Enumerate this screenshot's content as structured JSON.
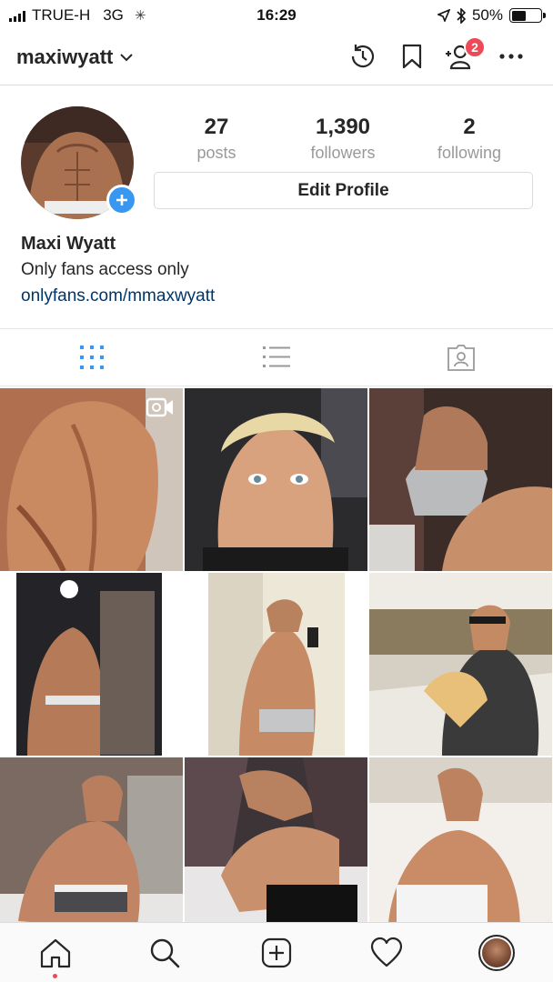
{
  "status_bar": {
    "carrier": "TRUE-H",
    "network": "3G",
    "time": "16:29",
    "battery": "50%",
    "battery_level": 0.5
  },
  "header": {
    "username": "maxiwyatt",
    "notification_count": "2"
  },
  "profile": {
    "stats": [
      {
        "value": "27",
        "label": "posts"
      },
      {
        "value": "1,390",
        "label": "followers"
      },
      {
        "value": "2",
        "label": "following"
      }
    ],
    "edit_button": "Edit Profile",
    "full_name": "Maxi Wyatt",
    "bio": "Only fans access only",
    "website": "onlyfans.com/mmaxwyatt"
  },
  "tabs": [
    {
      "name": "grid-view",
      "icon": "grid-icon",
      "active": true
    },
    {
      "name": "list-view",
      "icon": "list-icon",
      "active": false
    },
    {
      "name": "tagged",
      "icon": "tagged-person-icon",
      "active": false
    }
  ],
  "posts": [
    {
      "type": "video",
      "icon": "video-icon"
    },
    {
      "type": "photo"
    },
    {
      "type": "photo"
    },
    {
      "type": "photo"
    },
    {
      "type": "photo"
    },
    {
      "type": "photo"
    },
    {
      "type": "photo"
    },
    {
      "type": "photo"
    },
    {
      "type": "photo"
    }
  ],
  "nav": [
    "home-icon",
    "search-icon",
    "new-post-icon",
    "activity-heart-icon",
    "profile-avatar"
  ],
  "colors": {
    "accent": "#3897f0",
    "badge": "#ed4956",
    "link": "#003569",
    "muted": "#999999"
  }
}
